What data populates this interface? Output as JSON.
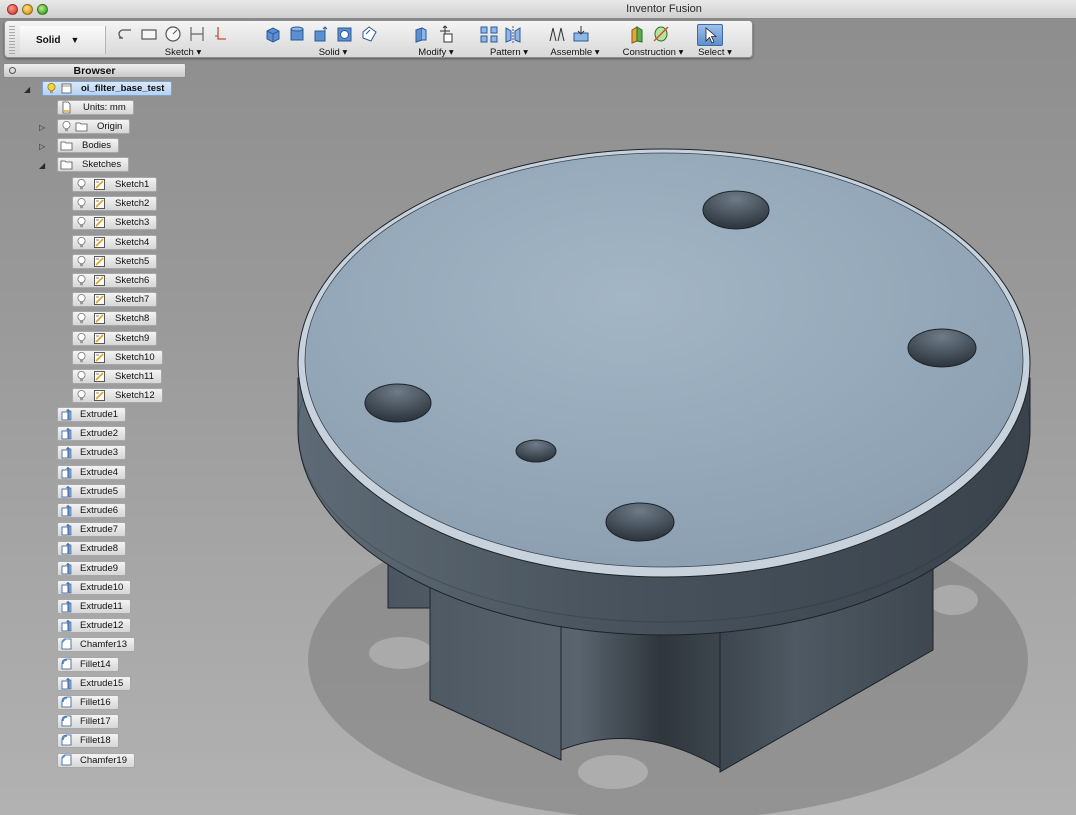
{
  "window": {
    "title": "Inventor Fusion"
  },
  "toolbar": {
    "mode_label": "Solid",
    "groups": [
      {
        "label": "Sketch"
      },
      {
        "label": "Solid"
      },
      {
        "label": "Modify"
      },
      {
        "label": "Pattern"
      },
      {
        "label": "Assemble"
      },
      {
        "label": "Construction"
      },
      {
        "label": "Select"
      }
    ]
  },
  "browser": {
    "title": "Browser",
    "root": "oi_filter_base_test",
    "units": "Units: mm",
    "folders": [
      "Origin",
      "Bodies",
      "Sketches"
    ],
    "sketches": [
      "Sketch1",
      "Sketch2",
      "Sketch3",
      "Sketch4",
      "Sketch5",
      "Sketch6",
      "Sketch7",
      "Sketch8",
      "Sketch9",
      "Sketch10",
      "Sketch11",
      "Sketch12"
    ],
    "features": [
      {
        "label": "Extrude1",
        "type": "extrude"
      },
      {
        "label": "Extrude2",
        "type": "extrude"
      },
      {
        "label": "Extrude3",
        "type": "extrude"
      },
      {
        "label": "Extrude4",
        "type": "extrude"
      },
      {
        "label": "Extrude5",
        "type": "extrude"
      },
      {
        "label": "Extrude6",
        "type": "extrude"
      },
      {
        "label": "Extrude7",
        "type": "extrude"
      },
      {
        "label": "Extrude8",
        "type": "extrude"
      },
      {
        "label": "Extrude9",
        "type": "extrude"
      },
      {
        "label": "Extrude10",
        "type": "extrude"
      },
      {
        "label": "Extrude11",
        "type": "extrude"
      },
      {
        "label": "Extrude12",
        "type": "extrude"
      },
      {
        "label": "Chamfer13",
        "type": "chamfer"
      },
      {
        "label": "Fillet14",
        "type": "fillet"
      },
      {
        "label": "Extrude15",
        "type": "extrude"
      },
      {
        "label": "Fillet16",
        "type": "fillet"
      },
      {
        "label": "Fillet17",
        "type": "fillet"
      },
      {
        "label": "Fillet18",
        "type": "fillet"
      },
      {
        "label": "Chamfer19",
        "type": "chamfer"
      }
    ]
  },
  "colors": {
    "selection": "#b6d1f1",
    "part_top": "#93a7b8",
    "part_side": "#4a5560"
  }
}
